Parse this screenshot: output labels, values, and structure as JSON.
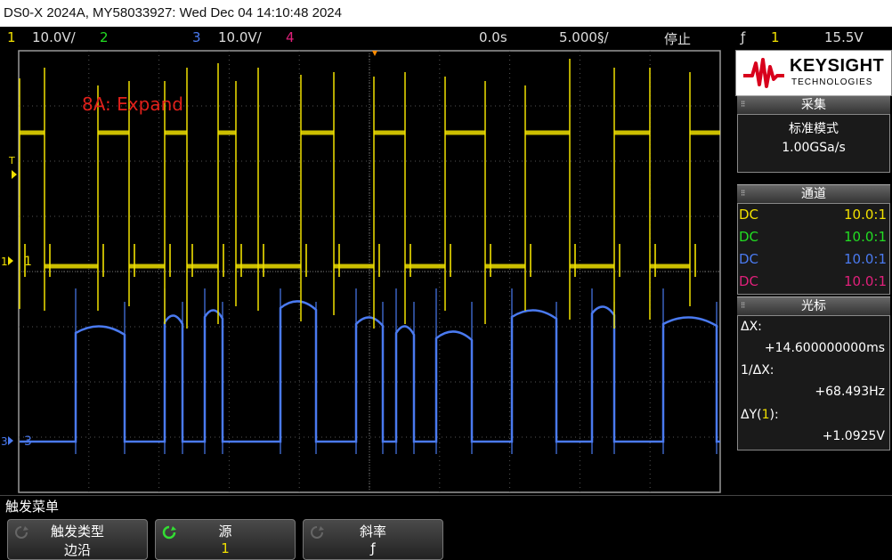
{
  "title": "DS0-X 2024A, MY58033927: Wed Dec 04 14:10:48 2024",
  "status": {
    "ch1_num": "1",
    "ch1_scale": "10.0V/",
    "ch2_num": "2",
    "ch3_num": "3",
    "ch3_scale": "10.0V/",
    "ch4_num": "4",
    "delay": "0.0s",
    "timebase": "5.000§/",
    "run_state": "停止",
    "trig_icon": "rising-edge-icon",
    "trig_glyph": "ƒ",
    "trig_src": "1",
    "trig_level": "15.5V"
  },
  "annotation": "8A: Expand",
  "markers": {
    "trigger_T": "T",
    "ch1": "1",
    "ch3": "3"
  },
  "panel": {
    "brand": "KEYSIGHT",
    "brand_sub": "TECHNOLOGIES",
    "acq_header": "采集",
    "acq_mode": "标准模式",
    "acq_rate": "1.00GSa/s",
    "chan_header": "通道",
    "channels": [
      {
        "coupling": "DC",
        "ratio": "10.0:1",
        "color": "#f0e000"
      },
      {
        "coupling": "DC",
        "ratio": "10.0:1",
        "color": "#22dd22"
      },
      {
        "coupling": "DC",
        "ratio": "10.0:1",
        "color": "#4a7af0"
      },
      {
        "coupling": "DC",
        "ratio": "10.0:1",
        "color": "#e0207a"
      }
    ],
    "cursor_header": "光标",
    "dx_label": "ΔX:",
    "dx_value": "+14.600000000ms",
    "inv_dx_label": "1/ΔX:",
    "inv_dx_value": "+68.493Hz",
    "dy_label_pre": "ΔY(",
    "dy_label_ch": "1",
    "dy_label_post": "):",
    "dy_value": "+1.0925V"
  },
  "menu": {
    "title": "触发菜单",
    "softkeys": [
      {
        "label": "触发类型",
        "value": "边沿"
      },
      {
        "label": "源",
        "value": "1"
      },
      {
        "label": "斜率",
        "value": "ƒ"
      }
    ]
  },
  "colors": {
    "ch1": "#f0e000",
    "ch2": "#22dd22",
    "ch3": "#4a7af0",
    "ch4": "#e0207a",
    "trigger": "#ff8c00",
    "annotation": "#e0201a"
  }
}
